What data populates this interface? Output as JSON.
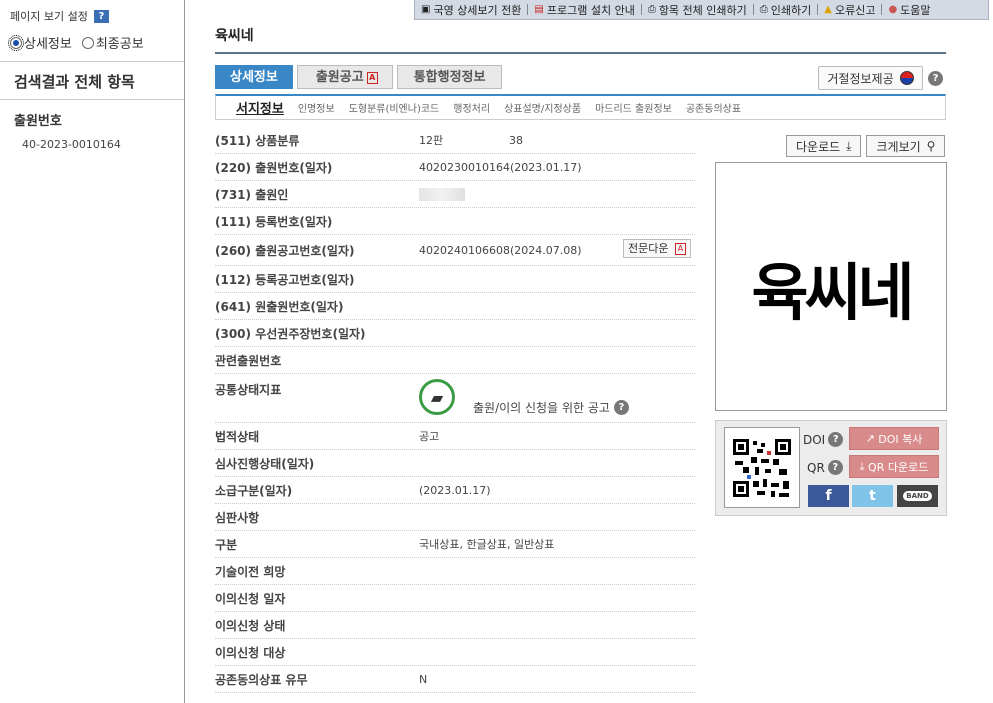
{
  "sidebar": {
    "settings_title": "페이지 보기 설정",
    "help": "?",
    "radio_detail": "상세정보",
    "radio_final": "최종공보",
    "all_items": "검색결과 전체 항목",
    "section_title": "출원번호",
    "section_value": "40-2023-0010164"
  },
  "topbar": {
    "items": [
      "국영 상세보기 전환",
      "프로그램 설치 안내",
      "항목 전체 인쇄하기",
      "인쇄하기",
      "오류신고",
      "도움말"
    ]
  },
  "title": "육씨네",
  "tabs": [
    "상세정보",
    "출원공고",
    "통합행정정보"
  ],
  "refuse_button": "거절정보제공",
  "subtabs": [
    "서지정보",
    "인명정보",
    "도형분류(비엔나)코드",
    "행정처리",
    "상표설명/지정상품",
    "마드리드 출원정보",
    "공존동의상표"
  ],
  "fields": [
    {
      "label": "(511) 상품분류",
      "value": "12판",
      "value2": "38"
    },
    {
      "label": "(220) 출원번호(일자)",
      "value": "4020230010164(2023.01.17)"
    },
    {
      "label": "(731) 출원인",
      "value": ""
    },
    {
      "label": "(111) 등록번호(일자)",
      "value": ""
    },
    {
      "label": "(260) 출원공고번호(일자)",
      "value": "4020240106608(2024.07.08)"
    },
    {
      "label": "(112) 등록공고번호(일자)",
      "value": ""
    },
    {
      "label": "(641) 원출원번호(일자)",
      "value": ""
    },
    {
      "label": "(300) 우선권주장번호(일자)",
      "value": ""
    },
    {
      "label": "관련출원번호",
      "value": ""
    },
    {
      "label": "공통상태지표",
      "value": "출원/이의 신청을 위한 공고"
    },
    {
      "label": "법적상태",
      "value": "공고"
    },
    {
      "label": "심사진행상태(일자)",
      "value": ""
    },
    {
      "label": "소급구분(일자)",
      "value": "(2023.01.17)"
    },
    {
      "label": "심판사항",
      "value": ""
    },
    {
      "label": "구분",
      "value": "국내상표, 한글상표, 일반상표"
    },
    {
      "label": "기술이전 희망",
      "value": ""
    },
    {
      "label": "이의신청 일자",
      "value": ""
    },
    {
      "label": "이의신청 상태",
      "value": ""
    },
    {
      "label": "이의신청 대상",
      "value": ""
    },
    {
      "label": "공존동의상표 유무",
      "value": "N"
    }
  ],
  "fulltext_button": "전문다운",
  "download_button": "다운로드",
  "zoom_button": "크게보기",
  "mark_text": "육씨네",
  "share": {
    "doi_label": "DOI",
    "qr_label": "QR",
    "doi_copy": "DOI 복사",
    "qr_download": "QR 다운로드",
    "facebook": "f",
    "twitter": "t",
    "band": "BAND"
  }
}
